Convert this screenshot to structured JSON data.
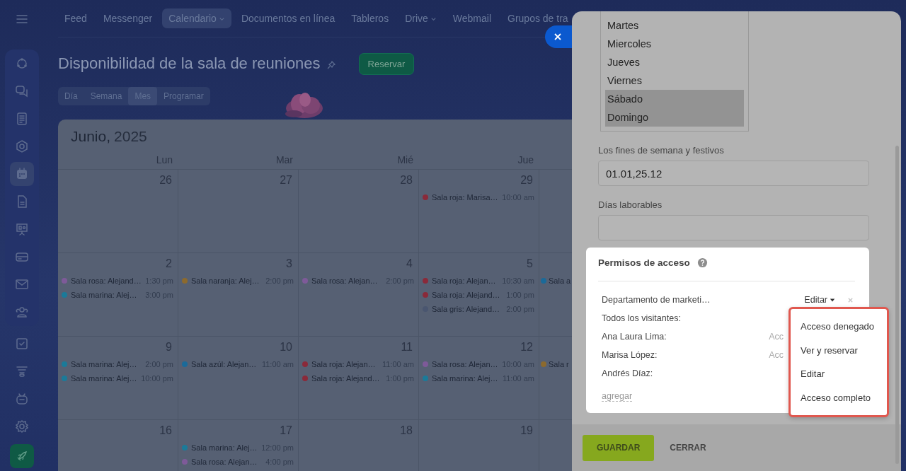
{
  "sidebar": {
    "items": [
      {
        "selected": false
      },
      {
        "selected": false
      },
      {
        "selected": false
      },
      {
        "selected": false
      },
      {
        "selected": true
      },
      {
        "selected": false
      },
      {
        "selected": false
      },
      {
        "selected": false
      },
      {
        "selected": false
      },
      {
        "selected": false
      },
      {
        "selected": false
      },
      {
        "selected": false
      },
      {
        "selected": false
      },
      {
        "selected": false
      }
    ]
  },
  "top_nav": {
    "items": [
      {
        "label": "Feed",
        "selected": false,
        "dropdown": false
      },
      {
        "label": "Messenger",
        "selected": false,
        "dropdown": false
      },
      {
        "label": "Calendario",
        "selected": true,
        "dropdown": true
      },
      {
        "label": "Documentos en línea",
        "selected": false,
        "dropdown": false
      },
      {
        "label": "Tableros",
        "selected": false,
        "dropdown": false
      },
      {
        "label": "Drive",
        "selected": false,
        "dropdown": true
      },
      {
        "label": "Webmail",
        "selected": false,
        "dropdown": false
      },
      {
        "label": "Grupos de tra",
        "selected": false,
        "dropdown": false
      }
    ]
  },
  "page": {
    "title": "Disponibilidad de la sala de reuniones",
    "action": "Reservar",
    "view_tabs": [
      {
        "label": "Día",
        "selected": false
      },
      {
        "label": "Semana",
        "selected": false
      },
      {
        "label": "Mes",
        "selected": true
      },
      {
        "label": "Programar",
        "selected": false
      }
    ]
  },
  "calendar": {
    "month": "Junio,",
    "year": "2025",
    "columns": [
      "Lun",
      "Mar",
      "Mié",
      "Jue"
    ],
    "weeks": [
      {
        "days": [
          {
            "day": "26"
          },
          {
            "day": "27"
          },
          {
            "day": "28"
          },
          {
            "day": "29",
            "events": [
              {
                "title": "Sala roja: Marisa…",
                "time": "10:00 am",
                "color": "#8a2a3a"
              }
            ]
          }
        ]
      },
      {
        "days": [
          {
            "day": "2",
            "events": [
              {
                "title": "Sala rosa: Alejand…",
                "time": "1:30 pm",
                "color": "#7e5a99"
              },
              {
                "title": "Sala marina: Alej…",
                "time": "3:00 pm",
                "color": "#1b7a99"
              }
            ]
          },
          {
            "day": "3",
            "events": [
              {
                "title": "Sala naranja: Alej…",
                "time": "2:00 pm",
                "color": "#8c6a2e"
              }
            ]
          },
          {
            "day": "4",
            "events": [
              {
                "title": "Sala rosa: Alejan…",
                "time": "2:00 pm",
                "color": "#7e5a99"
              }
            ]
          },
          {
            "day": "5",
            "events": [
              {
                "title": "Sala roja: Alejan…",
                "time": "10:30 am",
                "color": "#8a2a3a"
              },
              {
                "title": "Sala roja: Alejand…",
                "time": "1:00 pm",
                "color": "#8a2a3a"
              },
              {
                "title": "Sala gris: Alejand…",
                "time": "2:00 pm",
                "color": "#4a5670"
              }
            ]
          },
          {
            "events": [
              {
                "title": "Sala a",
                "color": "#1b6a99"
              }
            ]
          }
        ]
      },
      {
        "days": [
          {
            "day": "9",
            "events": [
              {
                "title": "Sala marina: Alej…",
                "time": "2:00 pm",
                "color": "#1b7a99"
              },
              {
                "title": "Sala marina: Alej…",
                "time": "10:00 pm",
                "color": "#1b7a99"
              }
            ]
          },
          {
            "day": "10",
            "events": [
              {
                "title": "Sala azúl: Alejan…",
                "time": "11:00 am",
                "color": "#1b6a99"
              }
            ]
          },
          {
            "day": "11",
            "events": [
              {
                "title": "Sala roja: Alejan…",
                "time": "11:00 am",
                "color": "#8a2a3a"
              },
              {
                "title": "Sala roja: Alejand…",
                "time": "1:00 pm",
                "color": "#8a2a3a"
              }
            ]
          },
          {
            "day": "12",
            "events": [
              {
                "title": "Sala rosa: Alejan…",
                "time": "10:00 am",
                "color": "#7e5a99"
              },
              {
                "title": "Sala marina: Alej…",
                "time": "11:00 am",
                "color": "#1b7a99"
              }
            ]
          },
          {
            "events": [
              {
                "title": "Sala r",
                "color": "#8c6a2e"
              }
            ]
          }
        ]
      },
      {
        "days": [
          {
            "day": "16"
          },
          {
            "day": "17",
            "events": [
              {
                "title": "Sala marina: Alej…",
                "time": "12:00 pm",
                "color": "#1b7a99"
              },
              {
                "title": "Sala rosa: Alejan…",
                "time": "4:00 pm",
                "color": "#7e5a99"
              }
            ]
          },
          {
            "day": "18"
          },
          {
            "day": "19"
          }
        ]
      }
    ]
  },
  "settings_panel": {
    "weekdays_list": [
      {
        "label": "Martes",
        "selected": false
      },
      {
        "label": "Miercoles",
        "selected": false
      },
      {
        "label": "Jueves",
        "selected": false
      },
      {
        "label": "Viernes",
        "selected": false
      },
      {
        "label": "Sábado",
        "selected": true
      },
      {
        "label": "Domingo",
        "selected": true
      }
    ],
    "holidays": {
      "label": "Los fines de semana y festivos",
      "value": "01.01,25.12"
    },
    "working_days": {
      "label": "Días laborables"
    },
    "permissions": {
      "title": "Permisos de acceso",
      "rows": [
        {
          "name": "Departamento de marketi…",
          "access": "Editar",
          "kind": "dropdown",
          "removable": true
        },
        {
          "name": "Todos los visitantes:",
          "removable": false
        },
        {
          "name": "Ana Laura Lima:",
          "access": "Acc",
          "kind": "plain",
          "removable": false
        },
        {
          "name": "Marisa López:",
          "access": "Acc",
          "kind": "plain",
          "removable": false
        },
        {
          "name": "Andrés Díaz:",
          "removable": false
        }
      ],
      "add_link": "agregar",
      "menu": [
        "Acceso denegado",
        "Ver y reservar",
        "Editar",
        "Acceso completo"
      ]
    },
    "buttons": {
      "save": "GUARDAR",
      "close": "CERRAR"
    }
  }
}
